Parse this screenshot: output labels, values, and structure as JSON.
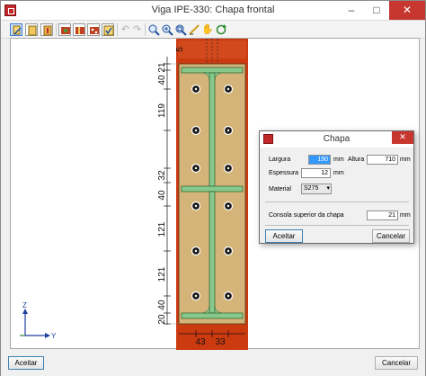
{
  "window": {
    "title": "Viga IPE-330: Chapa frontal"
  },
  "titlebar_buttons": {
    "minimize": "–",
    "maximize": "□",
    "close": "✕"
  },
  "toolbar": {
    "tools": [
      {
        "name": "edit-tool-icon",
        "active": true
      },
      {
        "name": "view-tool-icon"
      },
      {
        "name": "section-tool-icon"
      },
      {
        "name": "weld-tool-icon"
      },
      {
        "name": "stiffener-tool-icon"
      },
      {
        "name": "bolts-tool-icon"
      },
      {
        "name": "check-tool-icon"
      },
      {
        "name": "undo-icon",
        "disabled": true
      },
      {
        "name": "redo-icon",
        "disabled": true
      },
      {
        "name": "zoom-window-icon"
      },
      {
        "name": "zoom-in-icon"
      },
      {
        "name": "zoom-all-icon"
      },
      {
        "name": "measure-icon"
      },
      {
        "name": "pan-hand-icon"
      },
      {
        "name": "refresh-icon"
      }
    ]
  },
  "drawing": {
    "left_dims": [
      "5",
      "21",
      "40",
      "119",
      "32",
      "40",
      "121",
      "121",
      "40",
      "20"
    ],
    "bottom_dims": [
      "43",
      "33"
    ],
    "axis": {
      "z": "Z",
      "y": "Y"
    }
  },
  "dialog": {
    "title": "Chapa",
    "close": "✕",
    "largura_label": "Largura",
    "largura_value": "190",
    "largura_unit": "mm",
    "altura_label": "Altura",
    "altura_value": "710",
    "altura_unit": "mm",
    "espessura_label": "Espessura",
    "espessura_value": "12",
    "espessura_unit": "mm",
    "material_label": "Material",
    "material_value": "S275",
    "consola_label": "Consola superior da chapa",
    "consola_value": "21",
    "consola_unit": "mm",
    "accept": "Aceitar",
    "cancel": "Cancelar"
  },
  "bottom": {
    "accept": "Aceitar",
    "cancel": "Cancelar"
  },
  "colors": {
    "plate": "#d4b478",
    "column": "#cc3a10",
    "beam": "#86c98a",
    "close_red": "#c7372f"
  }
}
